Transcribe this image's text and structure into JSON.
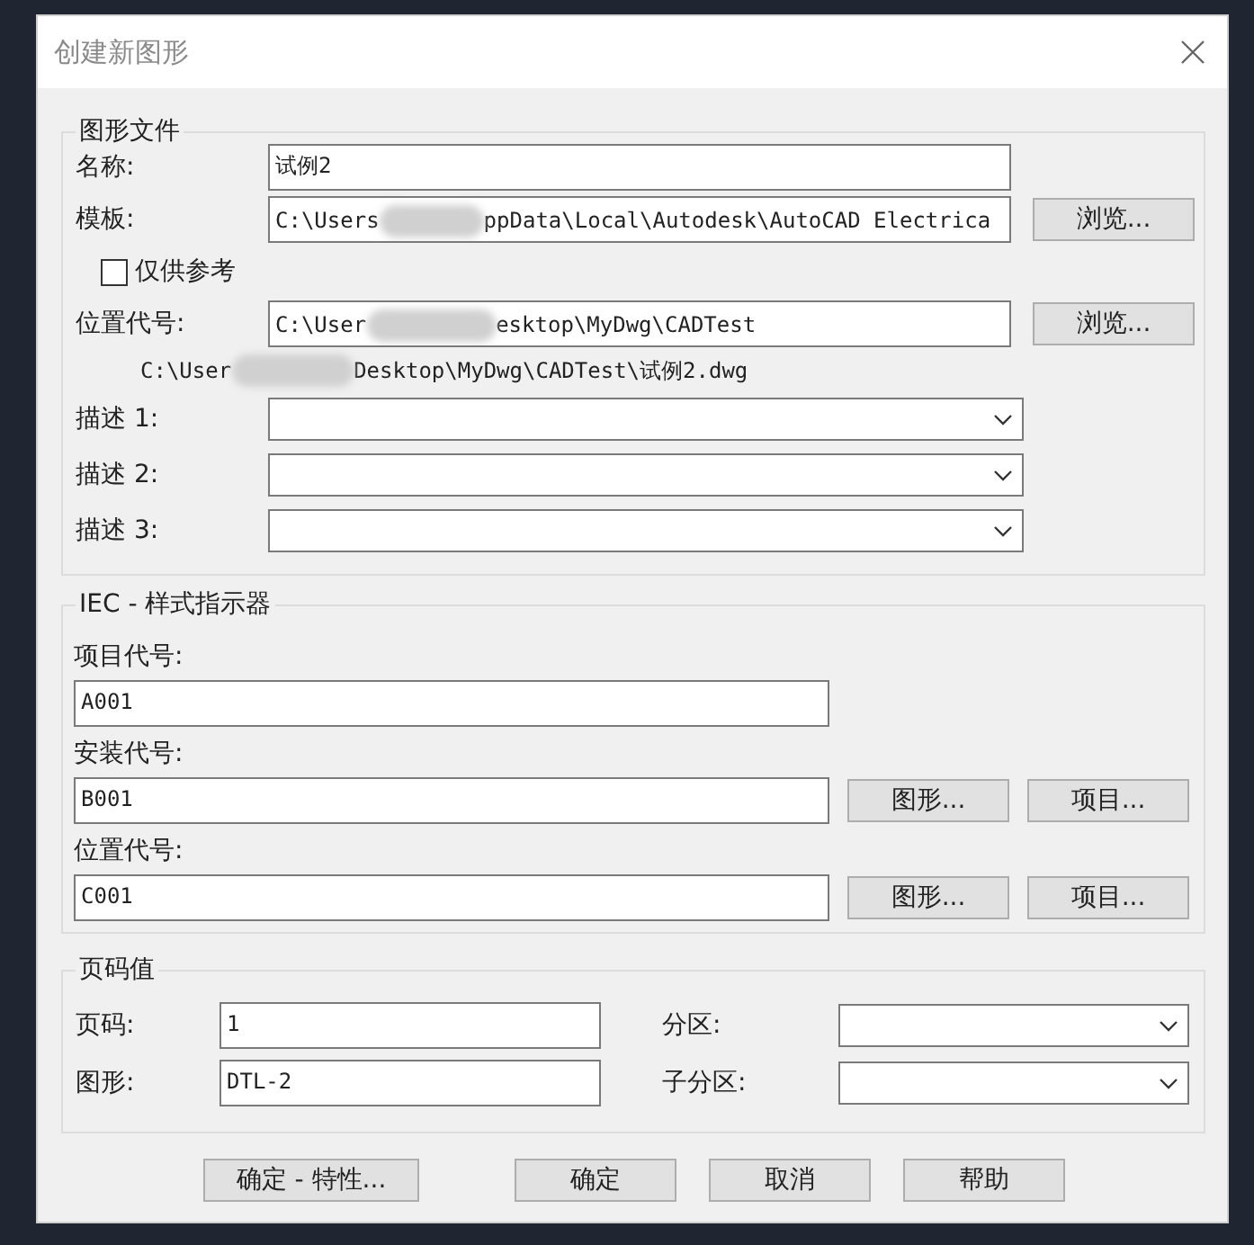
{
  "window": {
    "title": "创建新图形"
  },
  "drawing_file": {
    "legend": "图形文件",
    "name": {
      "label": "名称:",
      "value": "试例2"
    },
    "template": {
      "label": "模板:",
      "value_before": "C:\\Users",
      "value_after": "ppData\\Local\\Autodesk\\AutoCAD Electrica",
      "button": "浏览..."
    },
    "reference_only": {
      "label": "仅供参考",
      "checked": false
    },
    "location": {
      "label": "位置代号:",
      "value_before": "C:\\User",
      "value_after": "esktop\\MyDwg\\CADTest",
      "button": "浏览..."
    },
    "full_path": {
      "before": "C:\\User",
      "after": "Desktop\\MyDwg\\CADTest\\试例2.dwg"
    },
    "descriptions": [
      {
        "label": "描述 1:"
      },
      {
        "label": "描述 2:"
      },
      {
        "label": "描述 3:"
      }
    ]
  },
  "iec": {
    "legend": "IEC - 样式指示器",
    "fields": [
      {
        "label": "项目代号:",
        "value": "A001"
      },
      {
        "label": "安装代号:",
        "value": "B001",
        "buttons": [
          "图形...",
          "项目..."
        ]
      },
      {
        "label": "位置代号:",
        "value": "C001",
        "buttons": [
          "图形...",
          "项目..."
        ]
      }
    ]
  },
  "sheet": {
    "legend": "页码值",
    "page": {
      "label": "页码:",
      "value": "1"
    },
    "drawing": {
      "label": "图形:",
      "value": "DTL-2"
    },
    "section": {
      "label": "分区:"
    },
    "subsection": {
      "label": "子分区:"
    }
  },
  "buttons": [
    "确定 - 特性...",
    "确定",
    "取消",
    "帮助"
  ]
}
